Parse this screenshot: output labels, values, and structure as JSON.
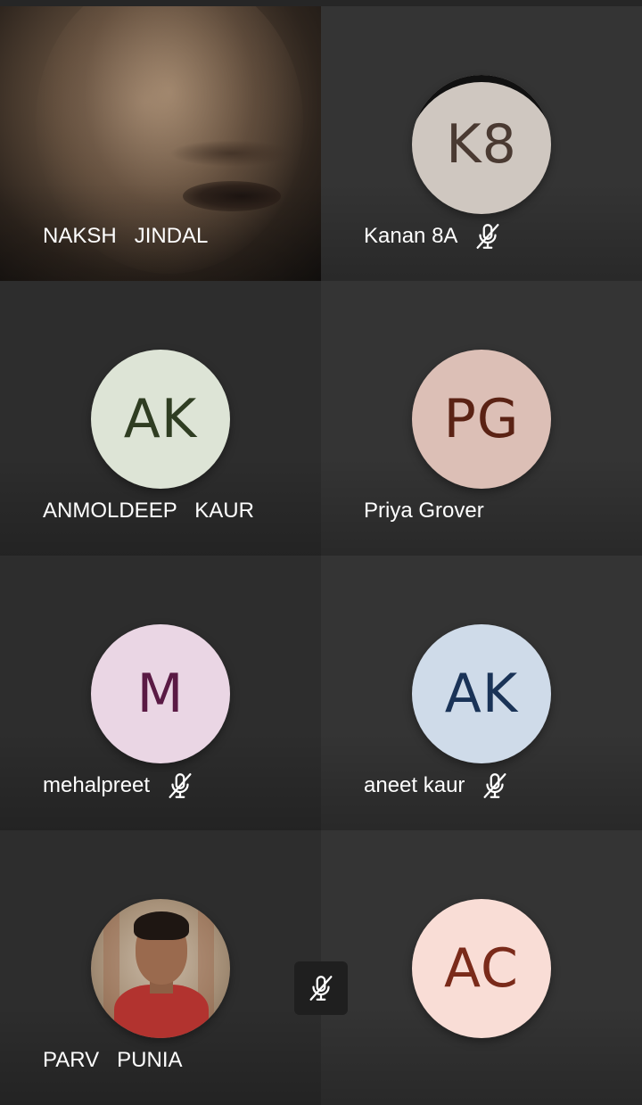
{
  "participants": [
    {
      "name": "NAKSH   JINDAL",
      "initials": "",
      "type": "video",
      "muted": false
    },
    {
      "name": "Kanan 8A",
      "initials": "K8",
      "type": "avatar",
      "muted": true,
      "avatar_bg": "#cfc7c0",
      "avatar_fg": "#4a3a32"
    },
    {
      "name": "ANMOLDEEP   KAUR",
      "initials": "AK",
      "type": "avatar",
      "muted": false,
      "avatar_bg": "#dde4d6",
      "avatar_fg": "#2f3d22"
    },
    {
      "name": "Priya Grover",
      "initials": "PG",
      "type": "avatar",
      "muted": false,
      "avatar_bg": "#dcbfb6",
      "avatar_fg": "#5a2214"
    },
    {
      "name": "mehalpreet",
      "initials": "M",
      "type": "avatar",
      "muted": true,
      "avatar_bg": "#ead6e4",
      "avatar_fg": "#5a1a44"
    },
    {
      "name": "aneet kaur",
      "initials": "AK",
      "type": "avatar",
      "muted": true,
      "avatar_bg": "#cfdbe9",
      "avatar_fg": "#1a3357"
    },
    {
      "name": "PARV   PUNIA",
      "initials": "",
      "type": "photo",
      "muted": false
    },
    {
      "name": "",
      "initials": "AC",
      "type": "avatar",
      "muted": false,
      "avatar_bg": "#f9ddd6",
      "avatar_fg": "#7a2a1a"
    }
  ],
  "self_mic": {
    "icon": "mic-off-icon",
    "muted": true
  },
  "colors": {
    "background": "#202020",
    "tile": "#2d2d2d",
    "tile_alt": "#343434",
    "text": "#ffffff"
  }
}
